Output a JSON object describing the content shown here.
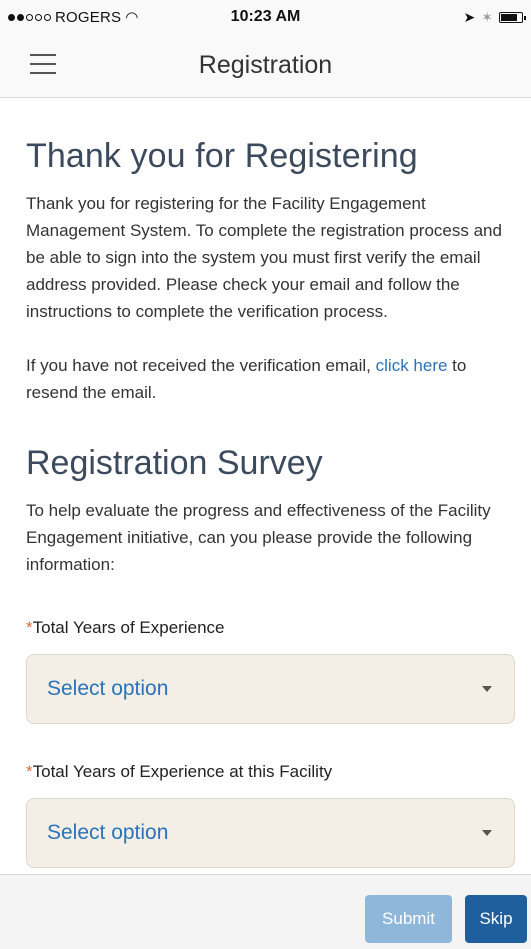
{
  "status_bar": {
    "carrier": "ROGERS",
    "time": "10:23 AM"
  },
  "nav": {
    "title": "Registration"
  },
  "thanks": {
    "heading": "Thank you for Registering",
    "para1": "Thank you for registering for the Facility Engagement Management System. To complete the registration process and be able to sign into the system you must first verify the email address provided. Please check your email and follow the instructions to complete the verification process.",
    "para2_before": "If you have not received the verification email, ",
    "para2_link": "click here",
    "para2_after": " to resend the email."
  },
  "survey": {
    "heading": "Registration Survey",
    "intro": "To help evaluate the progress and effectiveness of the Facility Engagement initiative, can you please provide the following information:",
    "fields": [
      {
        "required_mark": "*",
        "label": "Total Years of Experience",
        "value": "Select option"
      },
      {
        "required_mark": "*",
        "label": "Total Years of Experience at this Facility",
        "value": "Select option"
      }
    ]
  },
  "footer": {
    "submit_label": "Submit",
    "skip_label": "Skip"
  },
  "icons": {
    "menu": "hamburger-menu-icon",
    "wifi": "wifi-icon",
    "location": "location-arrow-icon",
    "bluetooth": "bluetooth-icon",
    "battery": "battery-icon",
    "dropdown": "caret-down-icon"
  },
  "colors": {
    "heading": "#3b4a5c",
    "link": "#2a73b9",
    "required": "#e06b3c",
    "submit_disabled": "#8fb7dc",
    "skip": "#1f5f9e",
    "select_bg": "#f3efe7"
  }
}
